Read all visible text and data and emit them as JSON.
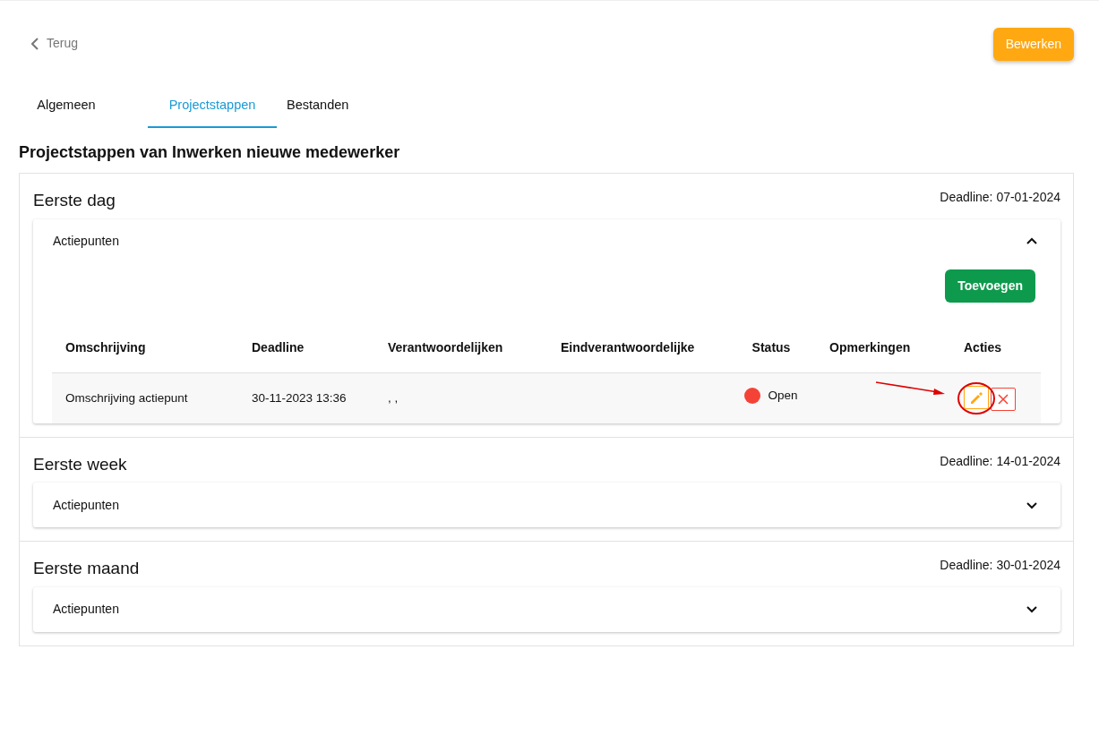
{
  "back_link": {
    "label": "Terug"
  },
  "edit_button": {
    "label": "Bewerken"
  },
  "tabs": [
    {
      "label": "Algemeen",
      "selected": false
    },
    {
      "label": "Projectstappen",
      "selected": true
    },
    {
      "label": "Bestanden",
      "selected": false
    }
  ],
  "heading": "Projectstappen van Inwerken nieuwe medewerker",
  "steps": [
    {
      "title": "Eerste dag",
      "deadline": "Deadline: 07-01-2024",
      "panel_title": "Actiepunten",
      "expanded": true,
      "add_button": "Toevoegen",
      "columns": [
        "Omschrijving",
        "Deadline",
        "Verantwoordelijken",
        "Eindverantwoordelijke",
        "Status",
        "Opmerkingen",
        "Acties"
      ],
      "rows": [
        {
          "description": "Omschrijving actiepunt",
          "deadline": "30-11-2023 13:36",
          "responsibles": ", ,",
          "status": "Open",
          "color": "#f44336",
          "actions": [
            {
              "kind": "edit",
              "highlighted": true
            },
            {
              "kind": "delete",
              "highlighted": false
            }
          ]
        }
      ]
    },
    {
      "title": "Eerste week",
      "deadline": "Deadline: 14-01-2024",
      "panel_title": "Actiepunten",
      "expanded": false
    },
    {
      "title": "Eerste maand",
      "deadline": "Deadline: 30-01-2024",
      "panel_title": "Actiepunten",
      "expanded": false
    }
  ]
}
